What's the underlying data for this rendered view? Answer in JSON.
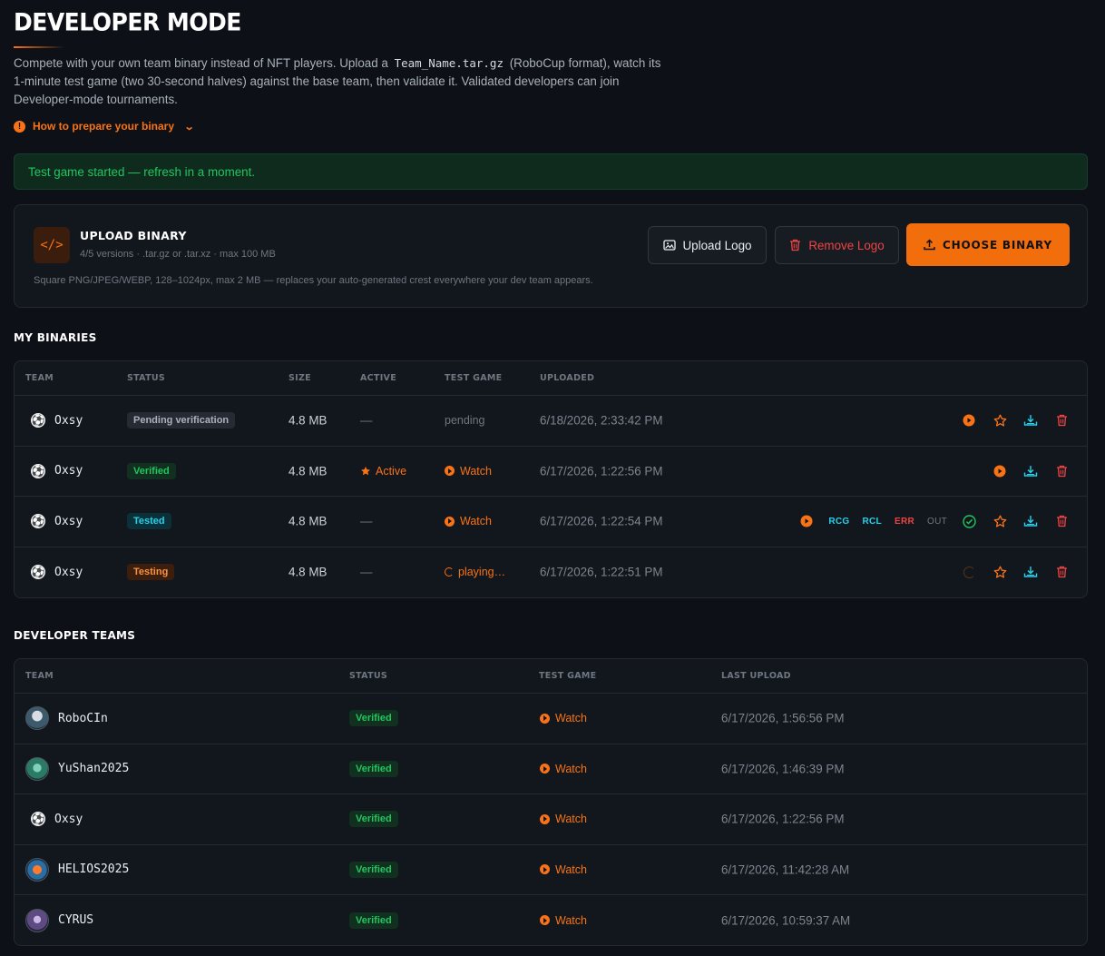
{
  "header": {
    "title": "DEVELOPER MODE",
    "intro_1": "Compete with your own team binary instead of NFT players. Upload a",
    "intro_code": "Team_Name.tar.gz",
    "intro_2": "(RoboCup format), watch its 1-minute test game (two 30-second halves) against the base team, then validate it. Validated developers can join Developer-mode tournaments.",
    "howto_label": "How to prepare your binary"
  },
  "banner": {
    "message": "Test game started — refresh in a moment."
  },
  "upload": {
    "title": "UPLOAD BINARY",
    "subtitle": "4/5 versions · .tar.gz or .tar.xz · max 100 MB",
    "hint": "Square PNG/JPEG/WEBP, 128–1024px, max 2 MB — replaces your auto-generated crest everywhere your dev team appears.",
    "upload_logo_label": "Upload Logo",
    "remove_logo_label": "Remove Logo",
    "choose_binary_label": "CHOOSE BINARY"
  },
  "my_binaries": {
    "section_title": "MY BINARIES",
    "columns": [
      "TEAM",
      "STATUS",
      "SIZE",
      "ACTIVE",
      "TEST GAME",
      "UPLOADED"
    ],
    "rows": [
      {
        "team": "Oxsy",
        "status": "Pending verification",
        "size": "4.8 MB",
        "active": "—",
        "test_game": "pending",
        "uploaded": "6/18/2026, 2:33:42 PM"
      },
      {
        "team": "Oxsy",
        "status": "Verified",
        "size": "4.8 MB",
        "active": "Active",
        "test_game": "Watch",
        "uploaded": "6/17/2026, 1:22:56 PM"
      },
      {
        "team": "Oxsy",
        "status": "Tested",
        "size": "4.8 MB",
        "active": "—",
        "test_game": "Watch",
        "uploaded": "6/17/2026, 1:22:54 PM",
        "tags": [
          "RCG",
          "RCL",
          "ERR",
          "OUT"
        ]
      },
      {
        "team": "Oxsy",
        "status": "Testing",
        "size": "4.8 MB",
        "active": "—",
        "test_game": "playing…",
        "uploaded": "6/17/2026, 1:22:51 PM"
      }
    ]
  },
  "developer_teams": {
    "section_title": "DEVELOPER TEAMS",
    "columns": [
      "TEAM",
      "STATUS",
      "TEST GAME",
      "LAST UPLOAD"
    ],
    "rows": [
      {
        "team": "RoboCIn",
        "status": "Verified",
        "test_game": "Watch",
        "last_upload": "6/17/2026, 1:56:56 PM",
        "crest": "robocin-crest-icon"
      },
      {
        "team": "YuShan2025",
        "status": "Verified",
        "test_game": "Watch",
        "last_upload": "6/17/2026, 1:46:39 PM",
        "crest": "yushan-crest-icon"
      },
      {
        "team": "Oxsy",
        "status": "Verified",
        "test_game": "Watch",
        "last_upload": "6/17/2026, 1:22:56 PM",
        "crest": "soccer-ball-icon"
      },
      {
        "team": "HELIOS2025",
        "status": "Verified",
        "test_game": "Watch",
        "last_upload": "6/17/2026, 11:42:28 AM",
        "crest": "helios-crest-icon"
      },
      {
        "team": "CYRUS",
        "status": "Verified",
        "test_game": "Watch",
        "last_upload": "6/17/2026, 10:59:37 AM",
        "crest": "cyrus-crest-icon"
      }
    ]
  },
  "colors": {
    "accent": "#f97316",
    "success": "#22c55e",
    "danger": "#ef4444",
    "info": "#22d3ee",
    "background": "#0d1117"
  }
}
